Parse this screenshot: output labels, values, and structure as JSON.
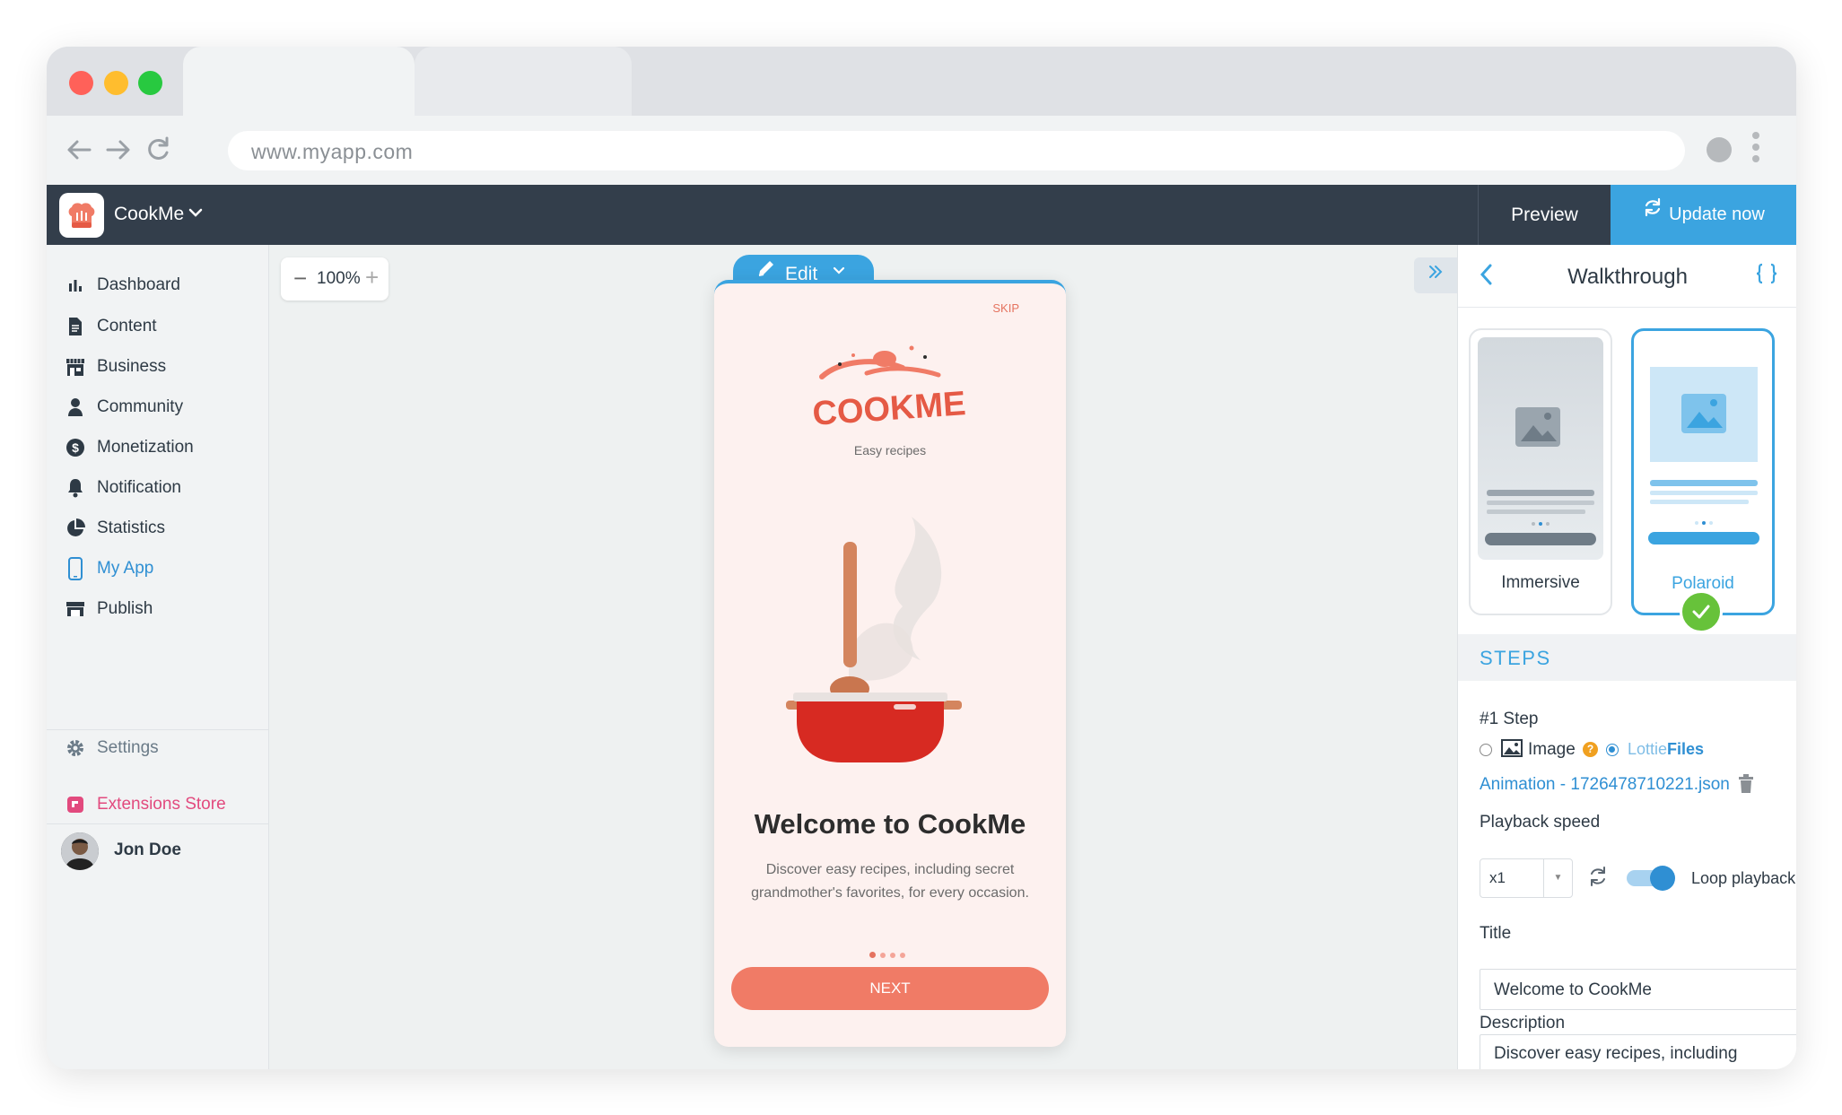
{
  "browser": {
    "url": "www.myapp.com",
    "colors": {
      "close": "#ff5f57",
      "minimize": "#febc2e",
      "maximize": "#28c840"
    }
  },
  "app": {
    "name": "CookMe",
    "preview_label": "Preview",
    "update_label": "Update now",
    "accent": "#3ba4e0"
  },
  "sidebar": {
    "items": [
      {
        "label": "Dashboard",
        "icon": "bar-chart-icon"
      },
      {
        "label": "Content",
        "icon": "document-icon"
      },
      {
        "label": "Business",
        "icon": "store-icon"
      },
      {
        "label": "Community",
        "icon": "person-icon"
      },
      {
        "label": "Monetization",
        "icon": "dollar-icon"
      },
      {
        "label": "Notification",
        "icon": "bell-icon"
      },
      {
        "label": "Statistics",
        "icon": "pie-chart-icon"
      },
      {
        "label": "My App",
        "icon": "phone-icon",
        "active": true
      },
      {
        "label": "Publish",
        "icon": "publish-icon"
      }
    ],
    "settings_label": "Settings",
    "extensions_label": "Extensions Store",
    "user_name": "Jon Doe"
  },
  "canvas": {
    "zoom": "100%",
    "edit_label": "Edit"
  },
  "phone": {
    "skip": "SKIP",
    "brand": "COOKME",
    "tagline": "Easy recipes",
    "title": "Welcome to CookMe",
    "description": "Discover easy recipes, including secret grandmother's favorites, for every occasion.",
    "next": "NEXT",
    "page_count": 4,
    "current_page": 1
  },
  "panel": {
    "title": "Walkthrough",
    "layouts": [
      {
        "label": "Immersive",
        "selected": false
      },
      {
        "label": "Polaroid",
        "selected": true
      }
    ],
    "steps_label": "STEPS",
    "step_label": "#1 Step",
    "image_option": "Image",
    "lottie_option_a": "Lottie",
    "lottie_option_b": "Files",
    "lottie_selected": true,
    "file_name": "Animation - 1726478710221.json",
    "playback_label": "Playback speed",
    "speed_value": "x1",
    "loop_label": "Loop playback",
    "loop_enabled": true,
    "title_label": "Title",
    "title_value": "Welcome to CookMe",
    "description_label": "Description",
    "description_value": "Discover easy recipes, including"
  }
}
